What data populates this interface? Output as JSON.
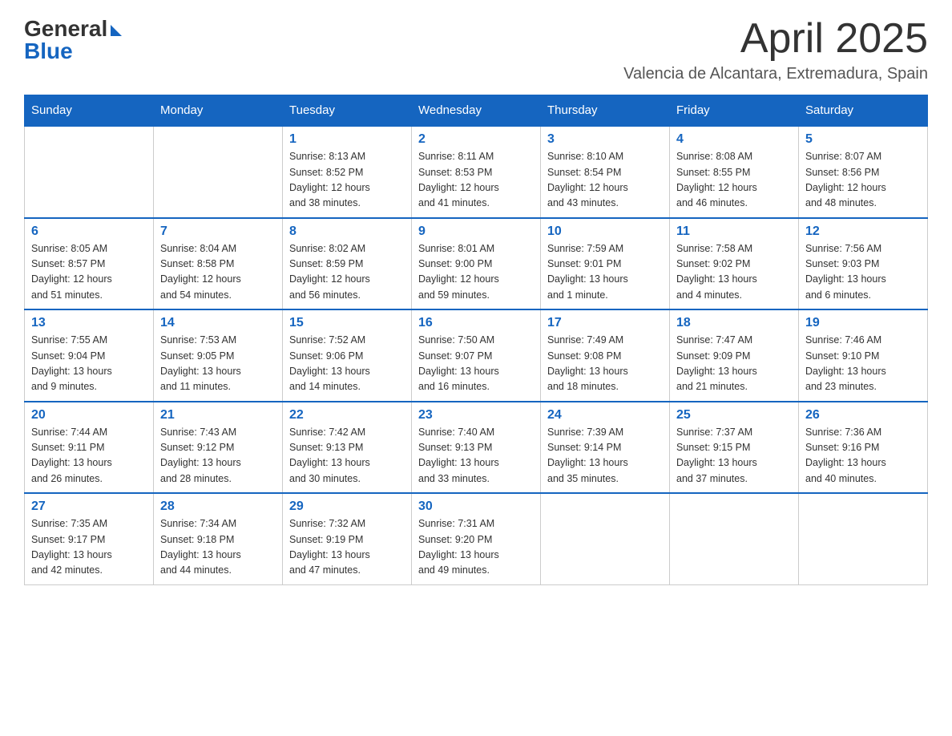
{
  "logo": {
    "general": "General",
    "blue": "Blue"
  },
  "title": {
    "month_year": "April 2025",
    "location": "Valencia de Alcantara, Extremadura, Spain"
  },
  "days_of_week": [
    "Sunday",
    "Monday",
    "Tuesday",
    "Wednesday",
    "Thursday",
    "Friday",
    "Saturday"
  ],
  "weeks": [
    [
      {
        "day": "",
        "info": ""
      },
      {
        "day": "",
        "info": ""
      },
      {
        "day": "1",
        "info": "Sunrise: 8:13 AM\nSunset: 8:52 PM\nDaylight: 12 hours\nand 38 minutes."
      },
      {
        "day": "2",
        "info": "Sunrise: 8:11 AM\nSunset: 8:53 PM\nDaylight: 12 hours\nand 41 minutes."
      },
      {
        "day": "3",
        "info": "Sunrise: 8:10 AM\nSunset: 8:54 PM\nDaylight: 12 hours\nand 43 minutes."
      },
      {
        "day": "4",
        "info": "Sunrise: 8:08 AM\nSunset: 8:55 PM\nDaylight: 12 hours\nand 46 minutes."
      },
      {
        "day": "5",
        "info": "Sunrise: 8:07 AM\nSunset: 8:56 PM\nDaylight: 12 hours\nand 48 minutes."
      }
    ],
    [
      {
        "day": "6",
        "info": "Sunrise: 8:05 AM\nSunset: 8:57 PM\nDaylight: 12 hours\nand 51 minutes."
      },
      {
        "day": "7",
        "info": "Sunrise: 8:04 AM\nSunset: 8:58 PM\nDaylight: 12 hours\nand 54 minutes."
      },
      {
        "day": "8",
        "info": "Sunrise: 8:02 AM\nSunset: 8:59 PM\nDaylight: 12 hours\nand 56 minutes."
      },
      {
        "day": "9",
        "info": "Sunrise: 8:01 AM\nSunset: 9:00 PM\nDaylight: 12 hours\nand 59 minutes."
      },
      {
        "day": "10",
        "info": "Sunrise: 7:59 AM\nSunset: 9:01 PM\nDaylight: 13 hours\nand 1 minute."
      },
      {
        "day": "11",
        "info": "Sunrise: 7:58 AM\nSunset: 9:02 PM\nDaylight: 13 hours\nand 4 minutes."
      },
      {
        "day": "12",
        "info": "Sunrise: 7:56 AM\nSunset: 9:03 PM\nDaylight: 13 hours\nand 6 minutes."
      }
    ],
    [
      {
        "day": "13",
        "info": "Sunrise: 7:55 AM\nSunset: 9:04 PM\nDaylight: 13 hours\nand 9 minutes."
      },
      {
        "day": "14",
        "info": "Sunrise: 7:53 AM\nSunset: 9:05 PM\nDaylight: 13 hours\nand 11 minutes."
      },
      {
        "day": "15",
        "info": "Sunrise: 7:52 AM\nSunset: 9:06 PM\nDaylight: 13 hours\nand 14 minutes."
      },
      {
        "day": "16",
        "info": "Sunrise: 7:50 AM\nSunset: 9:07 PM\nDaylight: 13 hours\nand 16 minutes."
      },
      {
        "day": "17",
        "info": "Sunrise: 7:49 AM\nSunset: 9:08 PM\nDaylight: 13 hours\nand 18 minutes."
      },
      {
        "day": "18",
        "info": "Sunrise: 7:47 AM\nSunset: 9:09 PM\nDaylight: 13 hours\nand 21 minutes."
      },
      {
        "day": "19",
        "info": "Sunrise: 7:46 AM\nSunset: 9:10 PM\nDaylight: 13 hours\nand 23 minutes."
      }
    ],
    [
      {
        "day": "20",
        "info": "Sunrise: 7:44 AM\nSunset: 9:11 PM\nDaylight: 13 hours\nand 26 minutes."
      },
      {
        "day": "21",
        "info": "Sunrise: 7:43 AM\nSunset: 9:12 PM\nDaylight: 13 hours\nand 28 minutes."
      },
      {
        "day": "22",
        "info": "Sunrise: 7:42 AM\nSunset: 9:13 PM\nDaylight: 13 hours\nand 30 minutes."
      },
      {
        "day": "23",
        "info": "Sunrise: 7:40 AM\nSunset: 9:13 PM\nDaylight: 13 hours\nand 33 minutes."
      },
      {
        "day": "24",
        "info": "Sunrise: 7:39 AM\nSunset: 9:14 PM\nDaylight: 13 hours\nand 35 minutes."
      },
      {
        "day": "25",
        "info": "Sunrise: 7:37 AM\nSunset: 9:15 PM\nDaylight: 13 hours\nand 37 minutes."
      },
      {
        "day": "26",
        "info": "Sunrise: 7:36 AM\nSunset: 9:16 PM\nDaylight: 13 hours\nand 40 minutes."
      }
    ],
    [
      {
        "day": "27",
        "info": "Sunrise: 7:35 AM\nSunset: 9:17 PM\nDaylight: 13 hours\nand 42 minutes."
      },
      {
        "day": "28",
        "info": "Sunrise: 7:34 AM\nSunset: 9:18 PM\nDaylight: 13 hours\nand 44 minutes."
      },
      {
        "day": "29",
        "info": "Sunrise: 7:32 AM\nSunset: 9:19 PM\nDaylight: 13 hours\nand 47 minutes."
      },
      {
        "day": "30",
        "info": "Sunrise: 7:31 AM\nSunset: 9:20 PM\nDaylight: 13 hours\nand 49 minutes."
      },
      {
        "day": "",
        "info": ""
      },
      {
        "day": "",
        "info": ""
      },
      {
        "day": "",
        "info": ""
      }
    ]
  ]
}
